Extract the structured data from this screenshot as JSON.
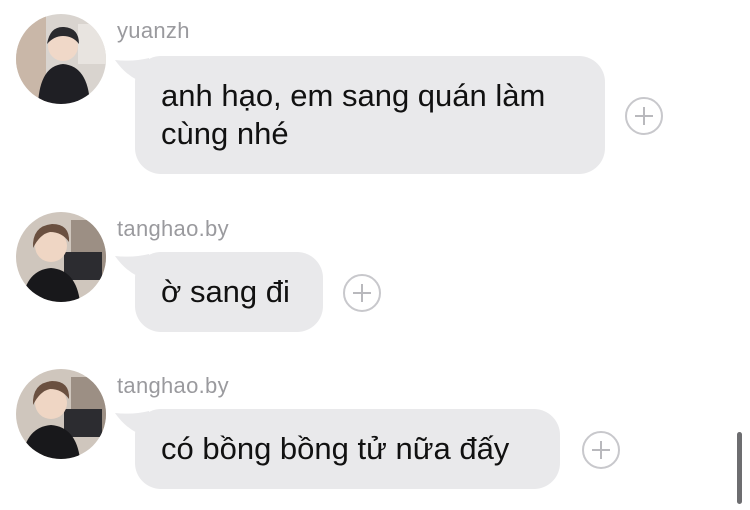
{
  "messages": [
    {
      "sender": "yuanzh",
      "text": "anh hạo, em sang quán làm cùng nhé",
      "avatar_icon": "user-avatar-photo"
    },
    {
      "sender": "tanghao.by",
      "text": "ờ sang đi",
      "avatar_icon": "user-avatar-photo"
    },
    {
      "sender": "tanghao.by",
      "text": "có bồng bồng tử nữa đấy",
      "avatar_icon": "user-avatar-photo"
    }
  ],
  "colors": {
    "bubble": "#e9e9eb",
    "sender": "#9a9a9e",
    "background": "#ffffff"
  }
}
